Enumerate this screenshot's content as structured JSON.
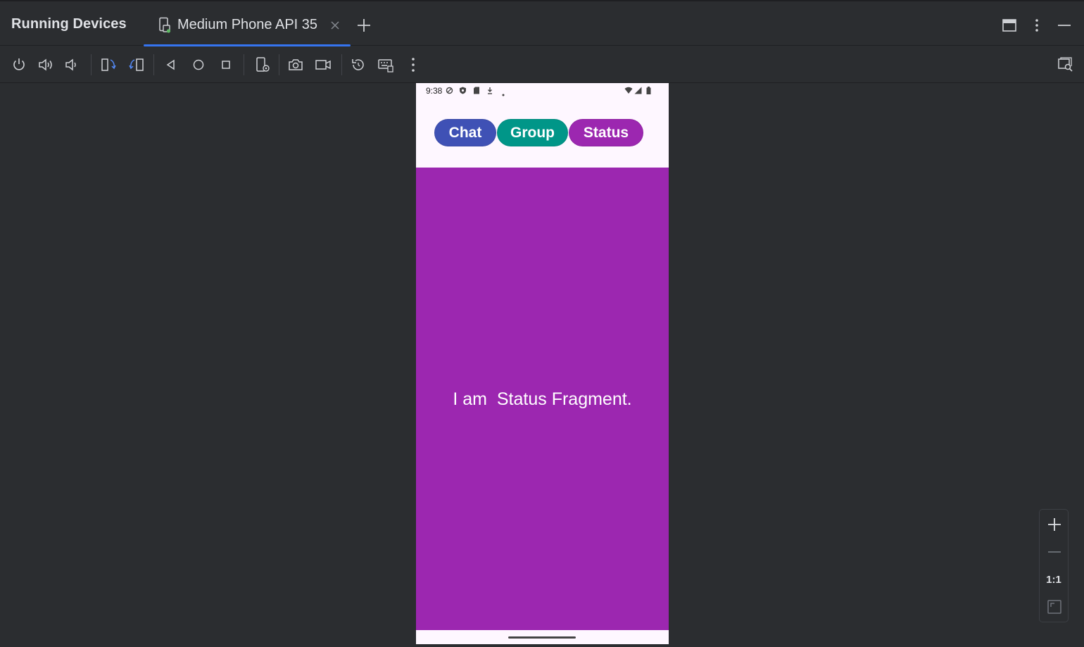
{
  "panel": {
    "title": "Running Devices"
  },
  "tab": {
    "label": "Medium Phone API 35",
    "close_icon": "close-icon",
    "add_icon": "add-tab-icon"
  },
  "title_actions": [
    "restore-layout-icon",
    "more-options-icon",
    "minimize-icon"
  ],
  "toolbar": {
    "buttons": [
      "power-icon",
      "volume-up-icon",
      "volume-down-icon",
      "rotate-left-icon",
      "rotate-right-icon",
      "back-icon",
      "home-icon",
      "overview-icon",
      "device-settings-icon",
      "screenshot-icon",
      "screen-record-icon",
      "reset-icon",
      "keyboard-icon",
      "more-icon"
    ],
    "right_button": "device-mirror-search-icon"
  },
  "phone": {
    "status_time": "9:38",
    "tabs": [
      {
        "label": "Chat",
        "color": "#3f51b5"
      },
      {
        "label": "Group",
        "color": "#009688"
      },
      {
        "label": "Status",
        "color": "#9c27b0"
      }
    ],
    "content_color": "#9c27b0",
    "fragment_text": "I am  Status Fragment."
  },
  "zoom": {
    "zoom_in_icon": "plus-icon",
    "zoom_out_icon": "minus-icon",
    "actual_size_label": "1:1",
    "fit_icon": "fit-screen-icon"
  }
}
